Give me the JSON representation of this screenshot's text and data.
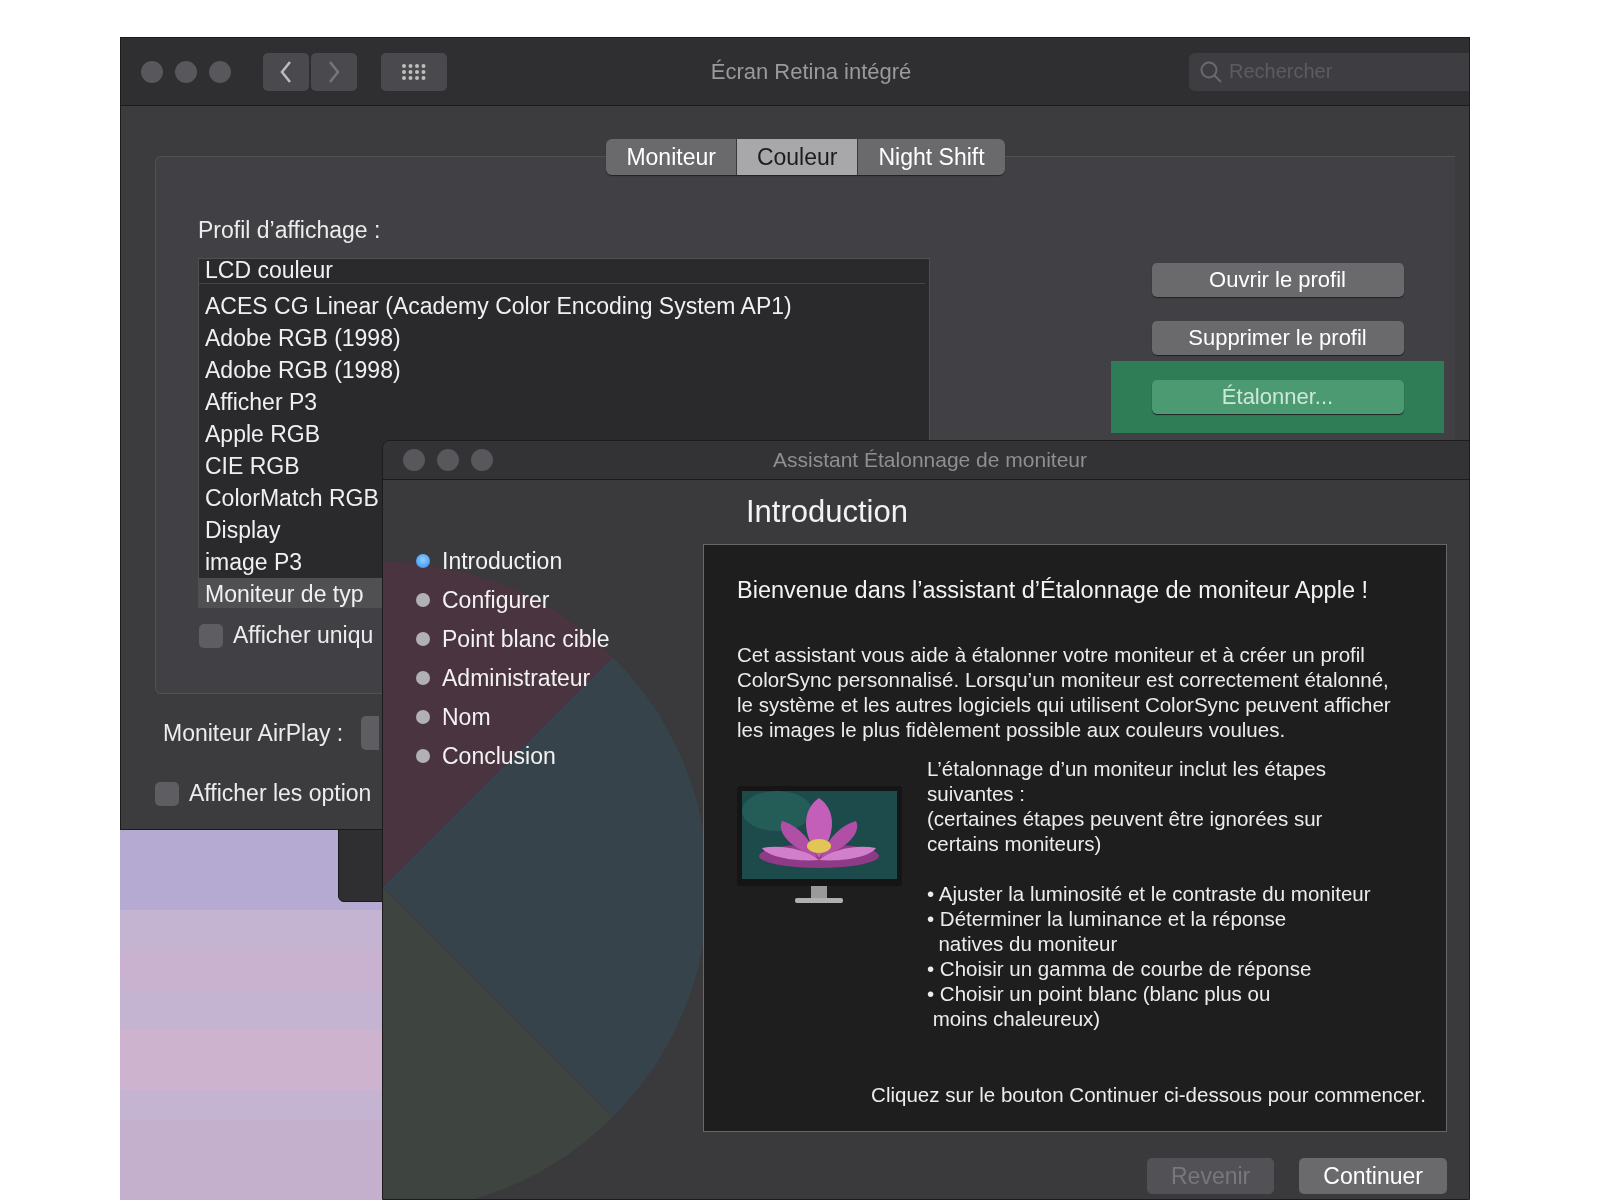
{
  "prefs_window": {
    "title": "Écran Retina intégré",
    "search": {
      "placeholder": "Rechercher"
    },
    "tabs": [
      {
        "label": "Moniteur",
        "selected": false
      },
      {
        "label": "Couleur",
        "selected": true
      },
      {
        "label": "Night Shift",
        "selected": false
      }
    ],
    "profile_label": "Profil d’affichage :",
    "profiles": [
      {
        "label": "LCD couleur",
        "selected": false
      },
      {
        "label": "ACES CG Linear (Academy Color Encoding System AP1)",
        "selected": false
      },
      {
        "label": "Adobe RGB (1998)",
        "selected": false
      },
      {
        "label": "Adobe RGB (1998)",
        "selected": false
      },
      {
        "label": "Afficher P3",
        "selected": false
      },
      {
        "label": "Apple RGB",
        "selected": false
      },
      {
        "label": "CIE RGB",
        "selected": false
      },
      {
        "label": "ColorMatch RGB",
        "selected": false
      },
      {
        "label": "Display",
        "selected": false
      },
      {
        "label": "image P3",
        "selected": false
      },
      {
        "label": "Moniteur de typ",
        "selected": true
      }
    ],
    "buttons": [
      "Ouvrir le profil",
      "Supprimer le profil"
    ],
    "calibrate_button": {
      "label": "Étalonner...",
      "highlighted": true
    },
    "show_only_checkbox": {
      "label": "Afficher uniqu",
      "checked": false
    },
    "airplay_label": "Moniteur AirPlay :",
    "show_options_checkbox": {
      "label": "Afficher les option",
      "checked": false
    }
  },
  "assistant_window": {
    "title": "Assistant Étalonnage de moniteur",
    "steps": [
      {
        "label": "Introduction",
        "selected": true
      },
      {
        "label": "Configurer",
        "selected": false
      },
      {
        "label": "Point blanc cible",
        "selected": false
      },
      {
        "label": "Administrateur",
        "selected": false
      },
      {
        "label": "Nom",
        "selected": false
      },
      {
        "label": "Conclusion",
        "selected": false
      }
    ],
    "heading": "Introduction",
    "welcome": "Bienvenue dans l’assistant d’Étalonnage de moniteur Apple !",
    "paragraph": "Cet assistant vous aide à étalonner votre moniteur et à créer un profil\nColorSync personnalisé. Lorsqu’un moniteur est correctement étalonné,\nle système et les autres logiciels qui utilisent ColorSync peuvent afficher\nles images le plus fidèlement possible aux couleurs voulues.",
    "steps_intro": "L’étalonnage d’un moniteur inclut les étapes\nsuivantes :\n(certaines étapes peuvent être ignorées sur\ncertains moniteurs)",
    "bullets": [
      "• Ajuster la luminosité et le contraste du moniteur",
      "• Déterminer la luminance et la réponse\n  natives du moniteur",
      "• Choisir un gamma de courbe de réponse",
      "• Choisir un point blanc (blanc plus ou\n moins chaleureux)"
    ],
    "footer": "Cliquez sur le bouton Continuer ci-dessous pour commencer.",
    "buttons": [
      {
        "label": "Revenir",
        "disabled": true
      },
      {
        "label": "Continuer",
        "disabled": false
      }
    ]
  }
}
